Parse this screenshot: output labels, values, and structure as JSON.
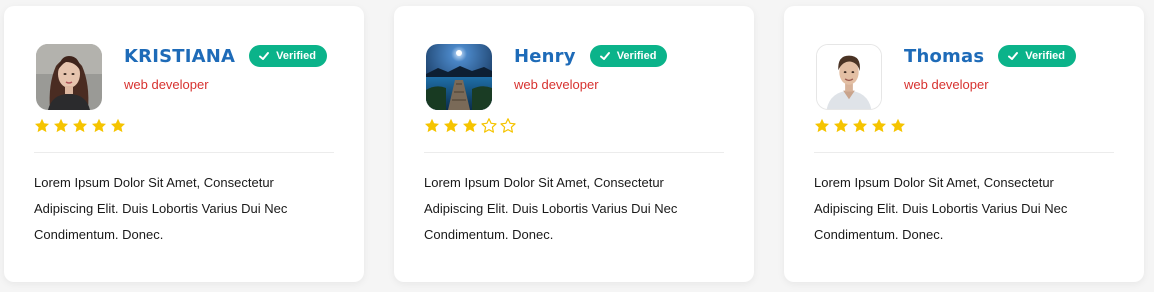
{
  "colors": {
    "name": "#1e6bb8",
    "role": "#d7322f",
    "badge": "#0bb38a",
    "star": "#f5c400"
  },
  "cards": [
    {
      "name": "KRISTIANA",
      "badge": "Verified",
      "role": "web developer",
      "rating": 5,
      "avatar_icon": "woman-portrait-photo",
      "description": "Lorem Ipsum Dolor Sit Amet, Consectetur Adipiscing Elit. Duis Lobortis Varius Dui Nec Condimentum. Donec."
    },
    {
      "name": "Henry",
      "badge": "Verified",
      "role": "web developer",
      "rating": 3,
      "avatar_icon": "night-lake-pier-photo",
      "description": "Lorem Ipsum Dolor Sit Amet, Consectetur Adipiscing Elit. Duis Lobortis Varius Dui Nec Condimentum. Donec."
    },
    {
      "name": "Thomas",
      "badge": "Verified",
      "role": "web developer",
      "rating": 5,
      "avatar_icon": "man-portrait-photo",
      "description": "Lorem Ipsum Dolor Sit Amet, Consectetur Adipiscing Elit. Duis Lobortis Varius Dui Nec Condimentum. Donec."
    }
  ],
  "max_rating": 5
}
